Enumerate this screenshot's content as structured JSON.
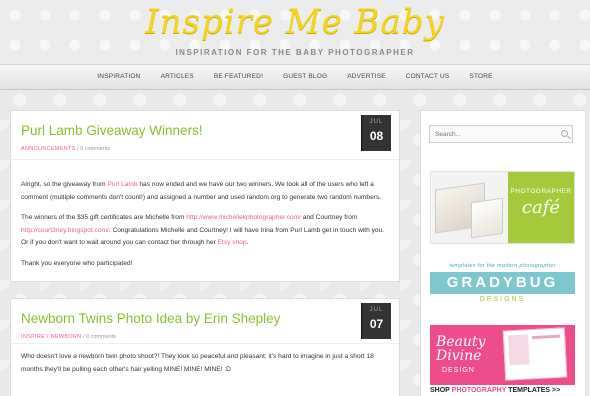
{
  "header": {
    "logo": "Inspire Me Baby",
    "tagline": "INSPIRATION FOR THE BABY PHOTOGRAPHER"
  },
  "nav": {
    "items": [
      "INSPIRATION",
      "ARTICLES",
      "BE FEATURED!",
      "GUEST BLOG",
      "ADVERTISE",
      "CONTACT US",
      "STORE"
    ]
  },
  "posts": [
    {
      "title": "Purl Lamb Giveaway Winners!",
      "category": "ANNOUNCEMENTS",
      "comments": "0 comments",
      "date_month": "JUL",
      "date_day": "08",
      "p1_a": "Alright, so the giveaway from ",
      "p1_link": "Purl Lamb",
      "p1_b": " has now ended and we have our two winners.  We took all of the users who left a comment (multiple comments don't count!) and assigned a number and used random.org to generate two random numbers.",
      "p2_a": "The winners of the $35 gift certificates are Michelle from ",
      "p2_link1": "http://www.michellekphotographer.com/",
      "p2_b": " and Courtney from ",
      "p2_link2": "http://court3ney.blogspot.com/",
      "p2_c": ".  Congratulations Michelle and Courtney!  I will have Irina from Purl Lamb get in touch with you.  Or if you don't want to wait around you can contact her through her ",
      "p2_link3": "Etsy shop",
      "p2_d": ".",
      "p3": "Thank you everyone who participated!"
    },
    {
      "title": "Newborn Twins Photo Idea by Erin Shepley",
      "category": "INSPIRE / NEWBORN",
      "comments": "0 comments",
      "date_month": "JUL",
      "date_day": "07",
      "p1": "Who doesn't love a newborn twin photo shoot?!  They look so peaceful and pleasant; it's hard to imagine in just a short 18 months they'll be pulling each other's hair yelling MINE! MINE! MINE! :D"
    }
  ],
  "sidebar": {
    "search_placeholder": "Search...",
    "ad1_line1": "PHOTOGRAPHER",
    "ad1_line2": "café",
    "ad2_tag": "templates for the modern photographer",
    "ad2_brand": "GRADYBUG",
    "ad2_sub": "DESIGNS",
    "ad3_line1": "Beauty",
    "ad3_line2": "Divine",
    "ad3_line3": "DESIGN",
    "ad3_cta_a": "SHOP ",
    "ad3_cta_b": "PHOTOGRAPHY",
    "ad3_cta_c": " TEMPLATES >>"
  },
  "colors": {
    "logo": "#f4d41f",
    "title_green": "#8dbd2f",
    "link_pink": "#e85b9a"
  }
}
